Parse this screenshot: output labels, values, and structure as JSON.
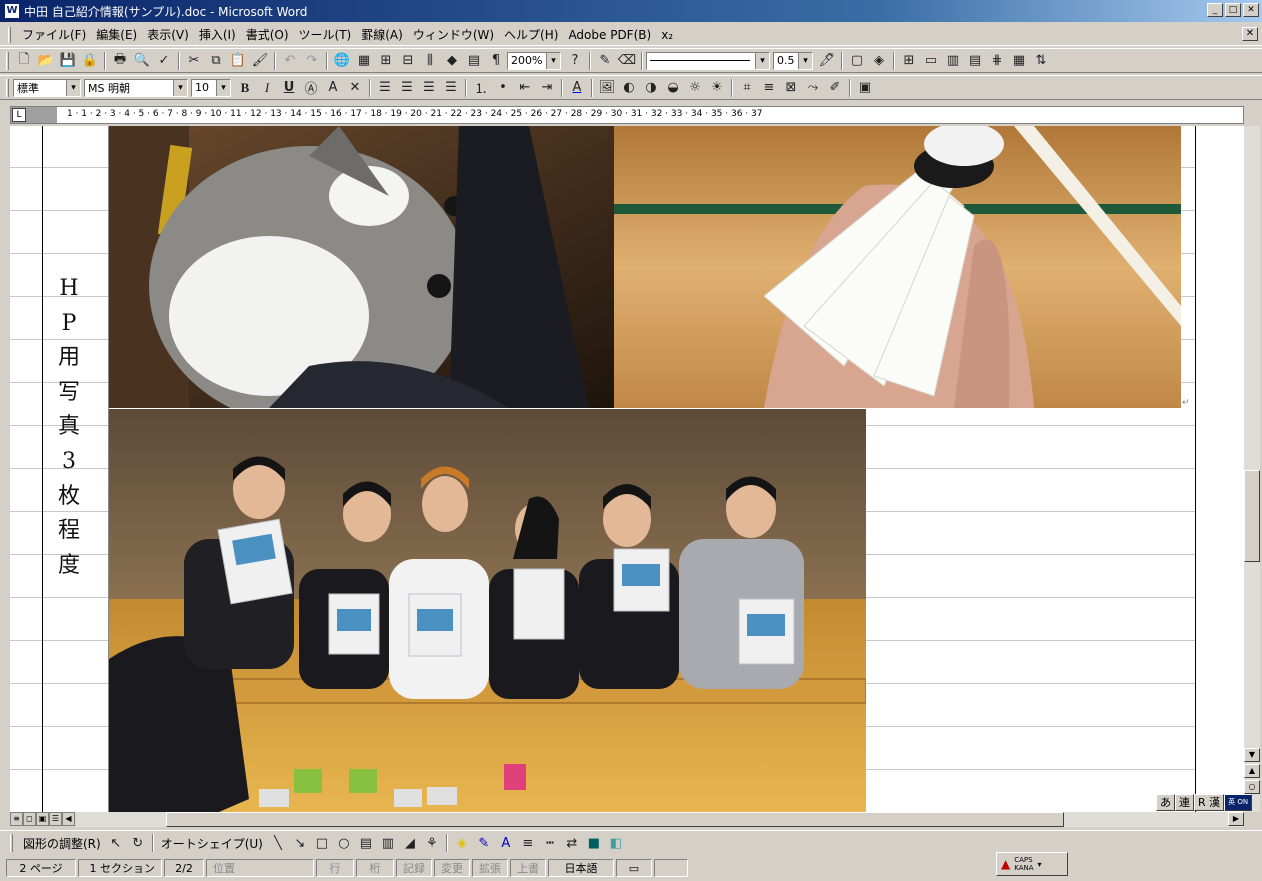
{
  "window": {
    "title": "中田 自己紹介情報(サンプル).doc - Microsoft Word",
    "app_icon": "W"
  },
  "menu": [
    "ファイル(F)",
    "編集(E)",
    "表示(V)",
    "挿入(I)",
    "書式(O)",
    "ツール(T)",
    "罫線(A)",
    "ウィンドウ(W)",
    "ヘルプ(H)",
    "Adobe PDF(B)",
    "x₂"
  ],
  "standard_toolbar": {
    "zoom": "200%",
    "line_weight": "0.5"
  },
  "format_toolbar": {
    "style": "標準",
    "font": "MS 明朝",
    "size": "10"
  },
  "ruler": {
    "corner": "L",
    "numbers": "1 · 1 · 2 · 3 · 4 · 5 · 6 · 7 · 8 · 9 · 10 · 11 · 12 · 13 · 14 · 15 · 16 · 17 · 18 · 19 · 20 · 21 · 22 · 23 · 24 · 25 · 26 · 27 · 28 · 29 · 30 · 31 · 32 · 33 · 34 · 35 · 36 · 37"
  },
  "document": {
    "vertical_label": [
      "H",
      "P",
      "用",
      "写",
      "真",
      "3",
      "枚",
      "程",
      "度"
    ],
    "paragraph_mark": "↵",
    "photos": [
      "cat-photo",
      "shuttlecock-photo",
      "team-photo"
    ]
  },
  "ime_bar": [
    "あ",
    "連",
    "R 漢",
    "英 ON"
  ],
  "drawing_toolbar": {
    "adjust": "図形の調整(R)",
    "autoshape": "オートシェイプ(U)"
  },
  "status": {
    "page": "2 ページ",
    "section": "1 セクション",
    "pages": "2/2",
    "position": "位置",
    "line": "行",
    "column": "桁",
    "rec": "記録",
    "trk": "変更",
    "ext": "拡張",
    "ovr": "上書",
    "lang": "日本語",
    "caps": "CAPS",
    "kana": "KANA"
  },
  "colors": {
    "title_start": "#0a246a",
    "title_end": "#a6caf0",
    "chrome": "#d4d0c8"
  }
}
